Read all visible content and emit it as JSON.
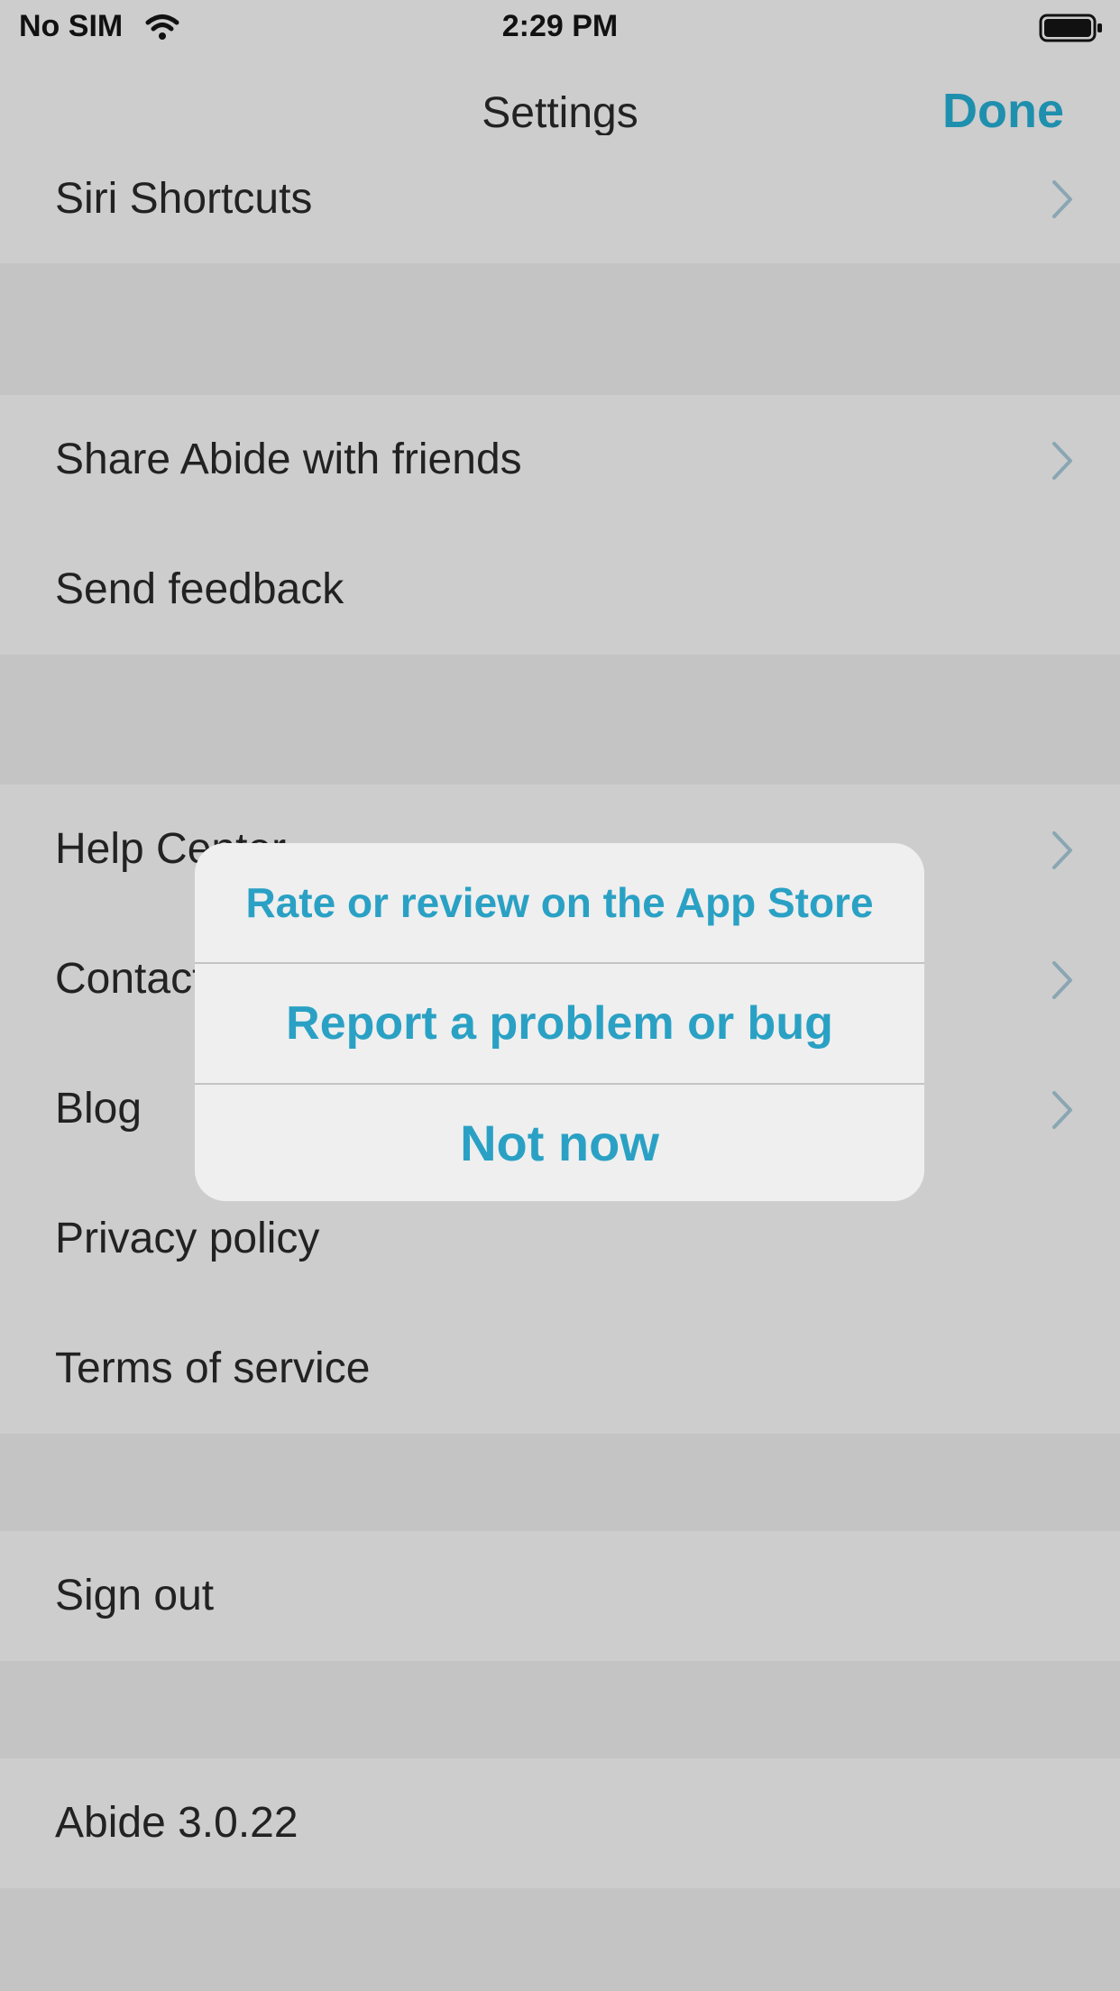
{
  "status_bar": {
    "carrier": "No SIM",
    "time": "2:29 PM",
    "wifi_icon": "wifi-icon",
    "battery_icon": "battery-icon"
  },
  "nav": {
    "title": "Settings",
    "done_label": "Done"
  },
  "rows": {
    "siri_shortcuts": "Siri Shortcuts",
    "share": "Share Abide with friends",
    "send_feedback": "Send feedback",
    "help_center": "Help Center",
    "contact": "Contact",
    "blog": "Blog",
    "privacy_policy": "Privacy policy",
    "terms_of_service": "Terms of service",
    "sign_out": "Sign out",
    "version": "Abide 3.0.22"
  },
  "alert": {
    "actions": [
      "Rate or review on the App Store",
      "Report a problem or bug",
      "Not now"
    ]
  },
  "colors": {
    "accent": "#2aa1c4",
    "background": "#cdcdcd",
    "section_gap": "#c4c4c4"
  }
}
